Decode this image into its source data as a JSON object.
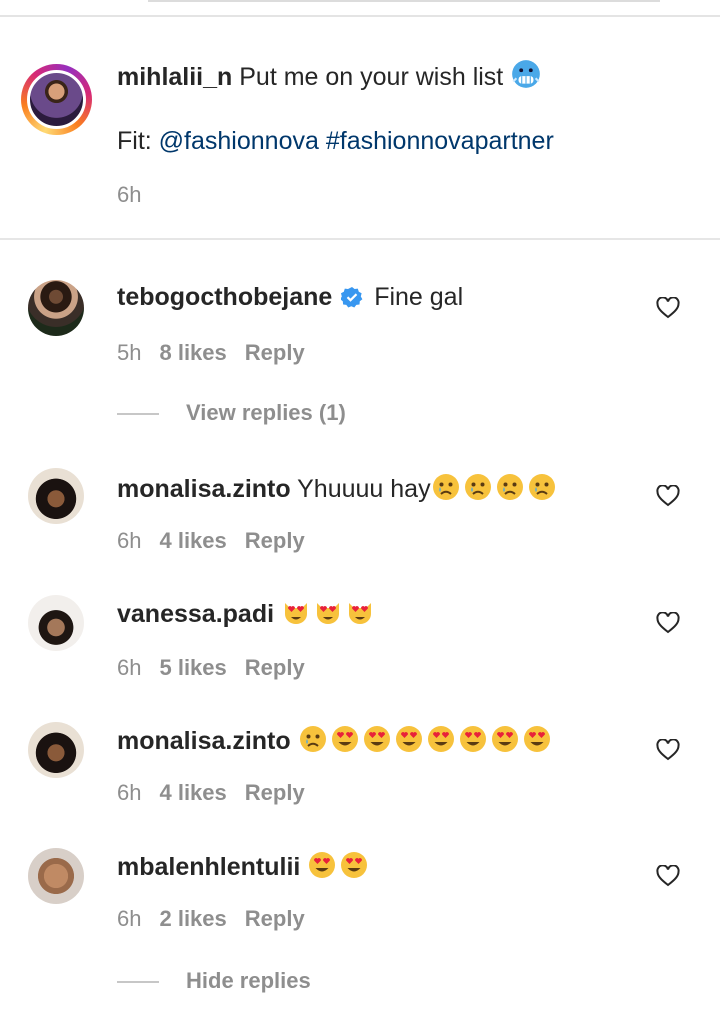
{
  "caption": {
    "username": "mihlalii_n",
    "text": " Put me on your wish list",
    "fit_prefix": "Fit: ",
    "mention": "@fashionnova",
    "hashtag": "#fashionnovapartner",
    "time": "6h"
  },
  "comments": [
    {
      "username": "tebogocthobejane",
      "verified": true,
      "text": "Fine gal",
      "emojis": [],
      "time": "5h",
      "likes": "8 likes",
      "reply": "Reply",
      "replies_toggle": "View replies (1)"
    },
    {
      "username": "monalisa.zinto",
      "verified": false,
      "text": " Yhuuuu hay",
      "emojis": [
        "crying-face",
        "crying-face",
        "crying-face",
        "crying-face"
      ],
      "time": "6h",
      "likes": "4 likes",
      "reply": "Reply"
    },
    {
      "username": "vanessa.padi",
      "verified": false,
      "text": " ",
      "emojis": [
        "heart-eyes-cat",
        "heart-eyes-cat",
        "heart-eyes-cat"
      ],
      "time": "6h",
      "likes": "5 likes",
      "reply": "Reply"
    },
    {
      "username": "monalisa.zinto",
      "verified": false,
      "text": " ",
      "emojis": [
        "crying-face",
        "heart-eyes",
        "heart-eyes",
        "heart-eyes",
        "heart-eyes",
        "heart-eyes",
        "heart-eyes",
        "heart-eyes"
      ],
      "time": "6h",
      "likes": "4 likes",
      "reply": "Reply"
    },
    {
      "username": "mbalenhlentulii",
      "verified": false,
      "text": " ",
      "emojis": [
        "heart-eyes",
        "heart-eyes"
      ],
      "time": "6h",
      "likes": "2 likes",
      "reply": "Reply",
      "replies_toggle": "Hide replies"
    }
  ],
  "colors": {
    "link": "#00376b",
    "muted": "#8e8e8e",
    "verified": "#3897f0"
  }
}
